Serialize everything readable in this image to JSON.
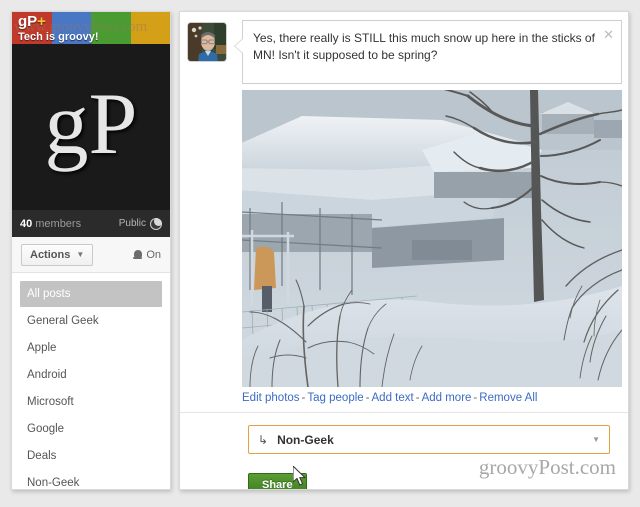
{
  "sidebar": {
    "banner": {
      "logo_text": "gP",
      "logo_plus": "+",
      "tagline": "Tech is groovy!",
      "watermark": "www.groovyPost.com",
      "colors": [
        "#c0392b",
        "#4a77c4",
        "#4a9b32",
        "#d4a017"
      ]
    },
    "logo_block": {
      "text": "gP"
    },
    "members": {
      "count": "40",
      "label": "members",
      "visibility": "Public",
      "globe_icon": "globe-icon"
    },
    "actions": {
      "button_label": "Actions",
      "caret_icon": "chevron-down-icon",
      "bell_icon": "bell-icon",
      "notify_state": "On"
    },
    "nav_items": [
      {
        "label": "All posts",
        "selected": true
      },
      {
        "label": "General Geek",
        "selected": false
      },
      {
        "label": "Apple",
        "selected": false
      },
      {
        "label": "Android",
        "selected": false
      },
      {
        "label": "Microsoft",
        "selected": false
      },
      {
        "label": "Google",
        "selected": false
      },
      {
        "label": "Deals",
        "selected": false
      },
      {
        "label": "Non-Geek",
        "selected": false
      }
    ]
  },
  "compose": {
    "avatar_name": "user-avatar",
    "post_text": "Yes, there really is STILL this much snow up here in the sticks of MN! Isn't it supposed to be spring?",
    "close_icon": "✕",
    "photo": {
      "name": "snow-photo",
      "description": "Snow covered farm buildings and bare trees in deep winter snow"
    },
    "photo_links": [
      {
        "label": "Edit photos"
      },
      {
        "label": "Tag people"
      },
      {
        "label": "Add text"
      },
      {
        "label": "Add more"
      },
      {
        "label": "Remove All"
      }
    ],
    "link_separator": "-",
    "audience": {
      "arrow_icon": "↳",
      "label": "Non-Geek",
      "caret_icon": "chevron-down-icon",
      "border_color": "#e0a33e"
    },
    "share_button": {
      "label": "Share",
      "color": "#4a8f2a"
    }
  },
  "watermark": "groovyPost.com"
}
